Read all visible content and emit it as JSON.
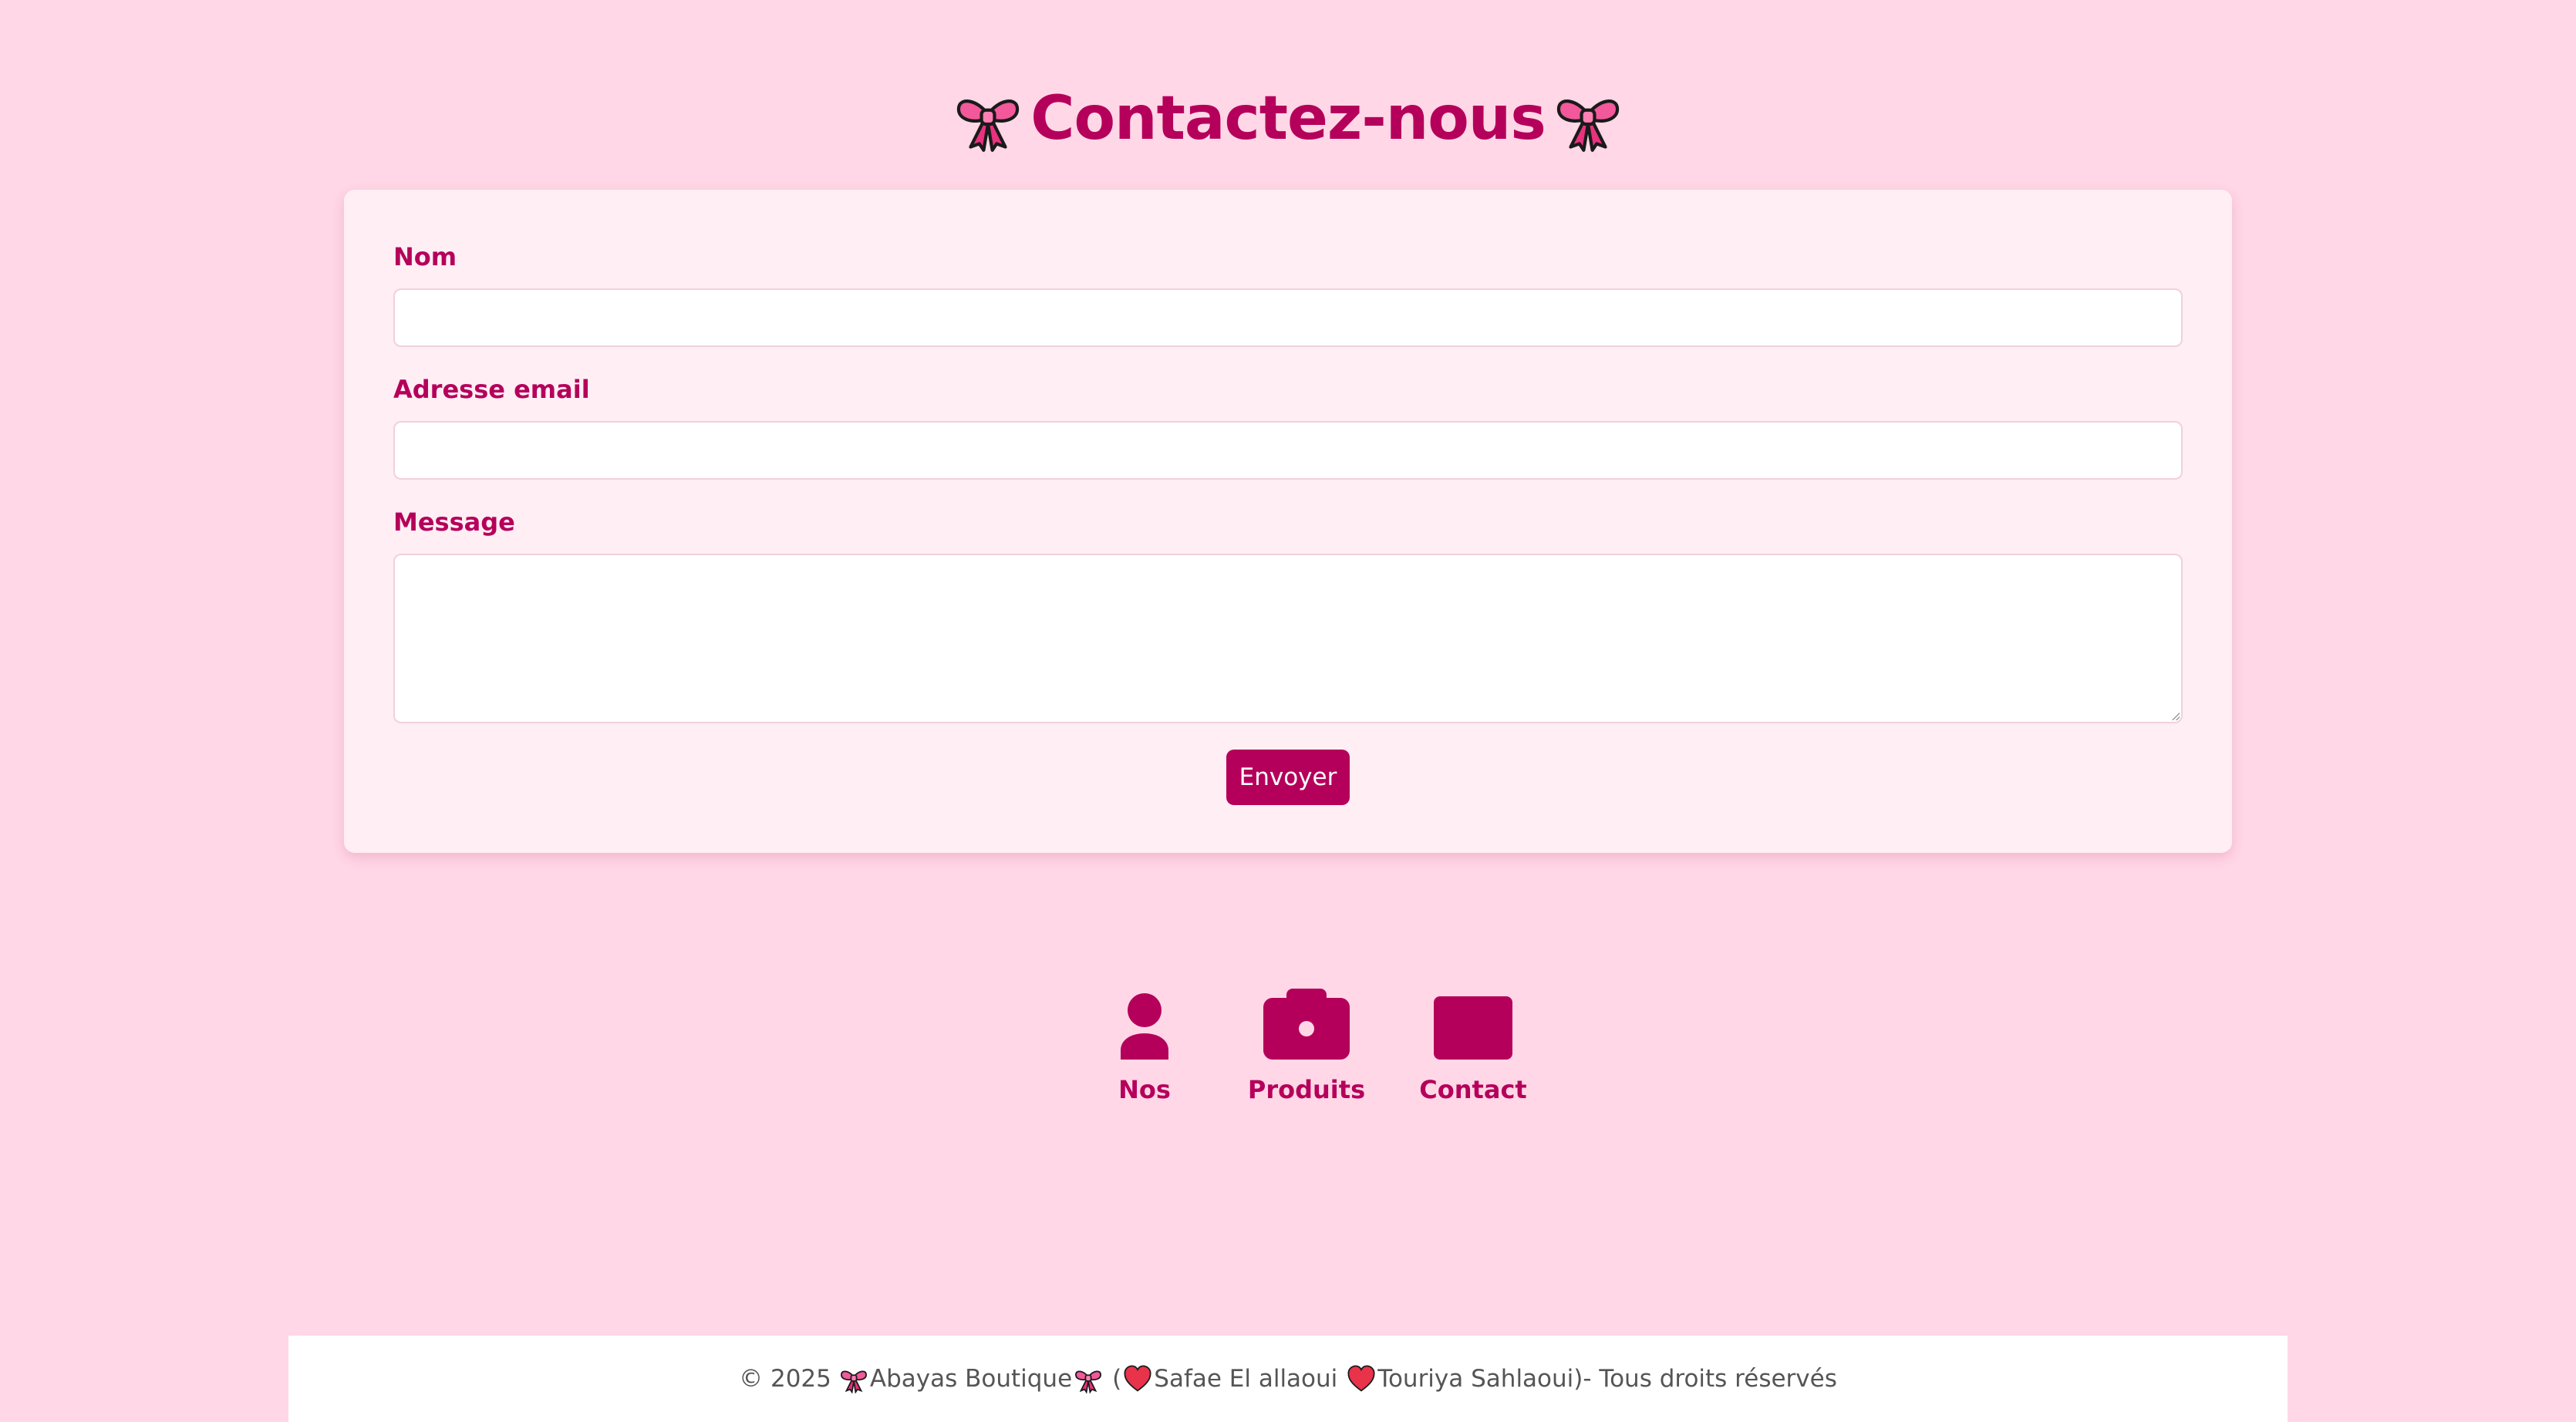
{
  "header": {
    "title": "Contactez-nous",
    "left_icon": "bow-icon",
    "right_icon": "bow-icon"
  },
  "form": {
    "name_label": "Nom",
    "name_value": "",
    "email_label": "Adresse email",
    "email_value": "",
    "message_label": "Message",
    "message_value": "",
    "submit_label": "Envoyer"
  },
  "nav": {
    "items": [
      {
        "label": "Nos",
        "icon": "user-icon"
      },
      {
        "label": "Produits",
        "icon": "camera-icon"
      },
      {
        "label": "Contact",
        "icon": "envelope-icon"
      }
    ]
  },
  "footer": {
    "year_text": "© 2025",
    "brand": "Abayas Boutique",
    "paren_open": "(",
    "author1": "Safae El allaoui",
    "author2": "Touriya Sahlaoui)- Tous droits réservés"
  },
  "colors": {
    "background": "#ffd7e6",
    "accent": "#b5005b",
    "card": "#ffeef4",
    "footer_bg": "#ffffff",
    "footer_text": "#555555"
  }
}
